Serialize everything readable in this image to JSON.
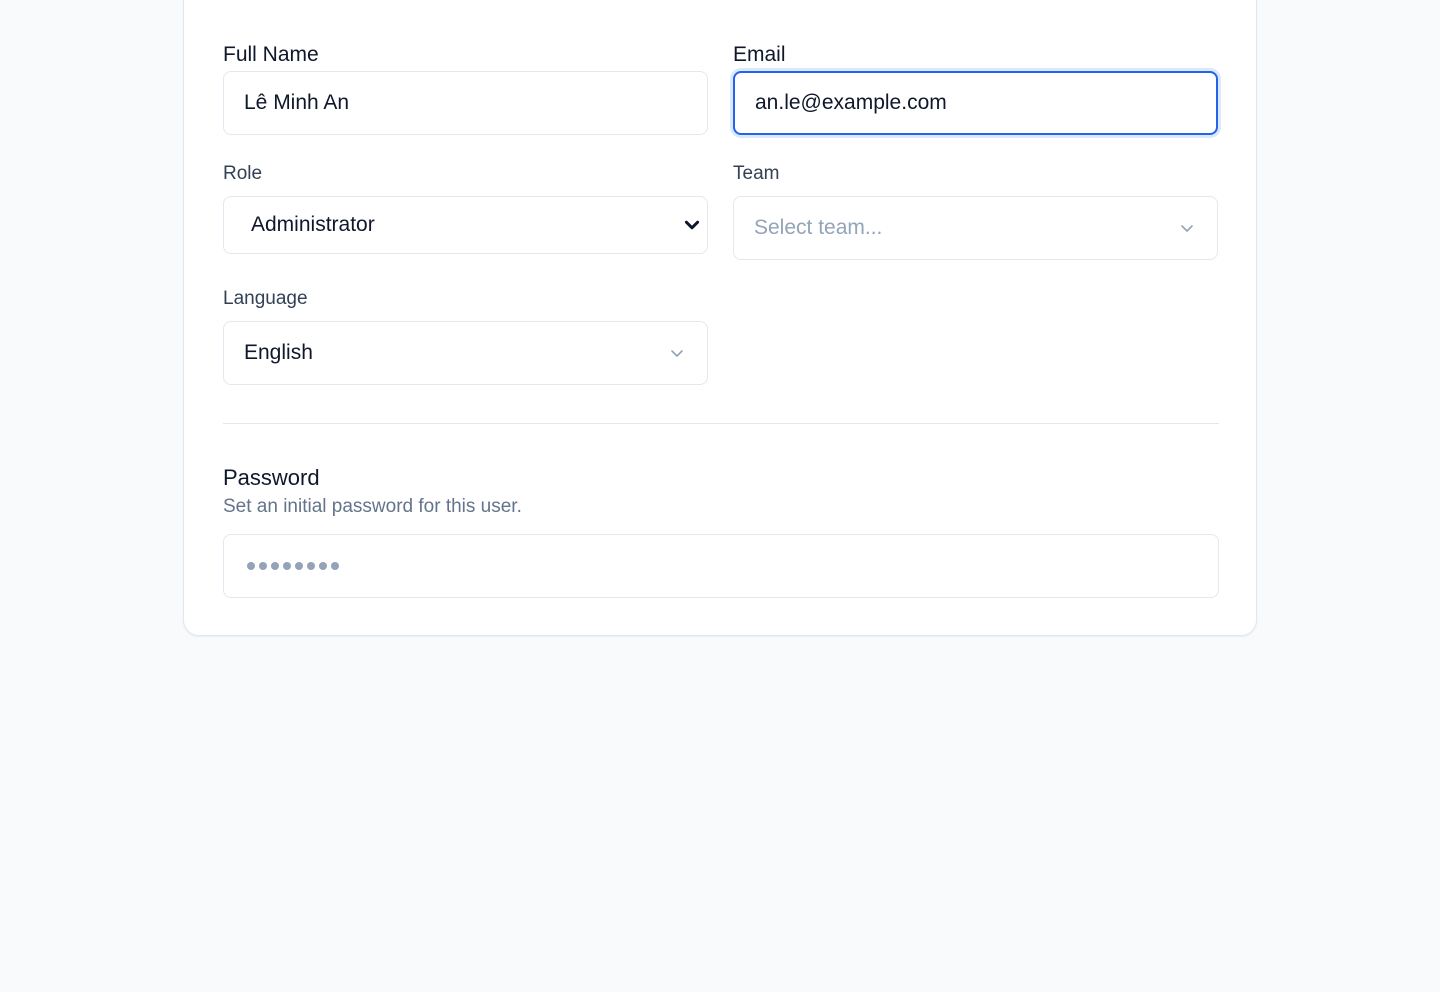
{
  "form": {
    "full_name": {
      "label": "Full Name",
      "value": "Lê Minh An"
    },
    "email": {
      "label": "Email",
      "value": "an.le@example.com"
    },
    "role": {
      "label": "Role",
      "value": "Administrator"
    },
    "team": {
      "label": "Team",
      "placeholder": "Select team..."
    },
    "language": {
      "label": "Language",
      "value": "English"
    }
  },
  "password_section": {
    "title": "Password",
    "description": "Set an initial password for this user.",
    "masked_length": 8
  },
  "icons": {
    "role_select": "chevron-down-icon",
    "team_select": "chevron-down-icon",
    "language_select": "chevron-down-icon"
  },
  "colors": {
    "focus": "#2563eb",
    "border": "#e2e8f0",
    "muted": "#64748b",
    "placeholder": "#94a3b8"
  }
}
